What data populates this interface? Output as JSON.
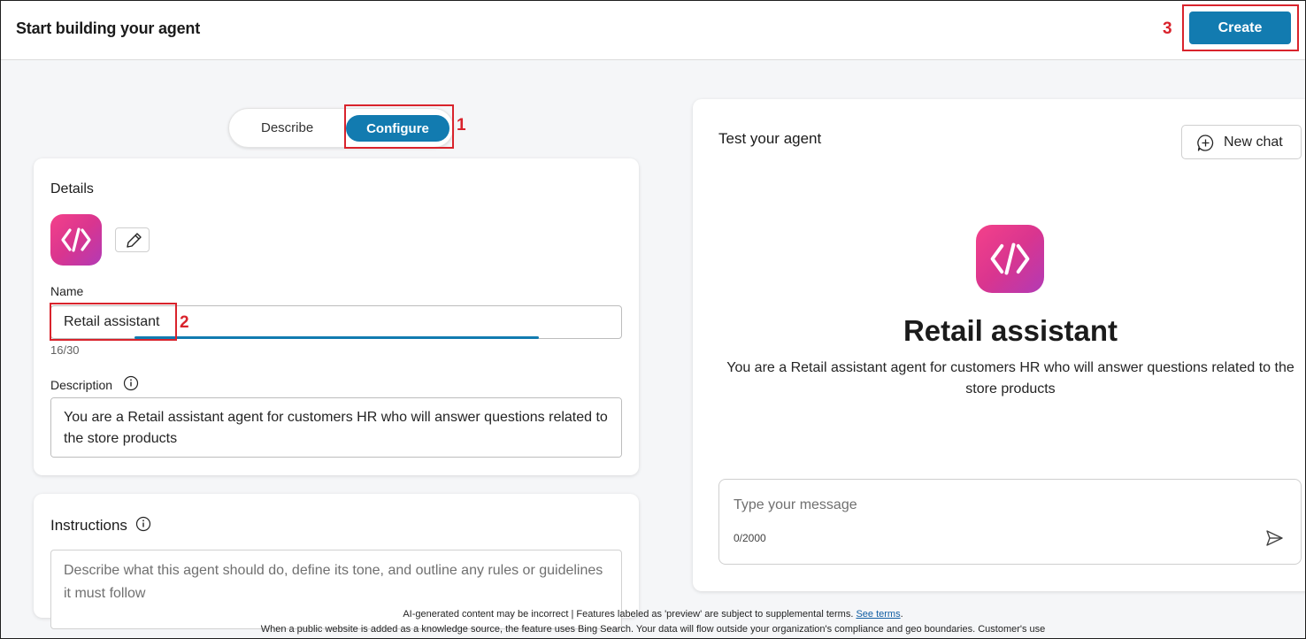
{
  "header": {
    "title": "Start building your agent",
    "create_label": "Create"
  },
  "callouts": {
    "one": "1",
    "two": "2",
    "three": "3"
  },
  "mode_toggle": {
    "describe_label": "Describe",
    "configure_label": "Configure",
    "selected": "Configure"
  },
  "details": {
    "section_title": "Details",
    "icon": "code-brackets-icon",
    "edit_icon": "pencil-icon",
    "name_label": "Name",
    "name_value": "Retail assistant",
    "name_counter": "16/30",
    "description_label": "Description",
    "description_value": "You are a Retail assistant agent for customers HR who will answer questions related to the store products"
  },
  "instructions": {
    "section_title": "Instructions",
    "placeholder": "Describe what this agent should do, define its tone, and outline any rules or guidelines it must follow"
  },
  "test_panel": {
    "title": "Test your agent",
    "new_chat_label": "New chat",
    "agent_name": "Retail assistant",
    "agent_description": "You are a Retail assistant agent for customers HR who will answer questions related to the store products",
    "message_placeholder": "Type your message",
    "message_counter": "0/2000"
  },
  "footer": {
    "line1_text": "AI-generated content may be incorrect | Features labeled as 'preview' are subject to supplemental terms.",
    "line1_link": "See terms",
    "line2_text": "When a public website is added as a knowledge source, the feature uses Bing Search. Your data will flow outside your organization's compliance and geo boundaries. Customer's use"
  },
  "colors": {
    "accent": "#127bb0",
    "callout": "#d9232c",
    "icon_gradient_start": "#f4418a",
    "icon_gradient_end": "#b23ab5"
  }
}
